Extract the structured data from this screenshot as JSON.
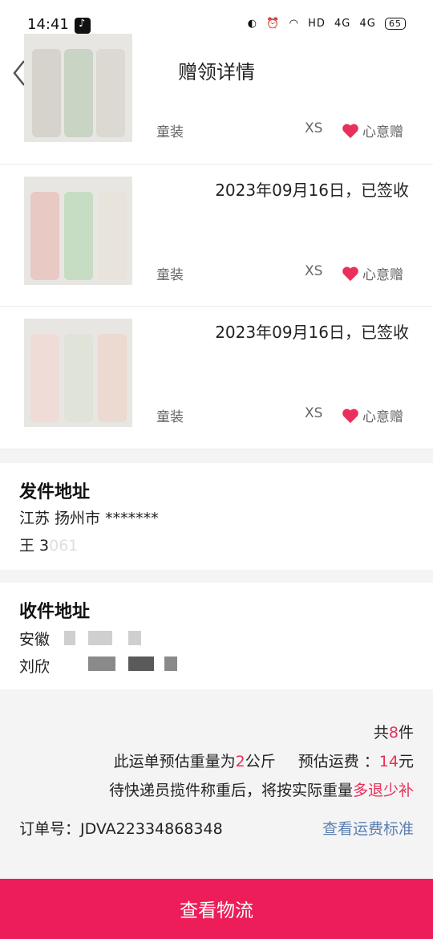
{
  "status": {
    "time": "14:41",
    "network": "HD",
    "signal1": "4G",
    "signal2": "4G",
    "battery": "65"
  },
  "nav": {
    "title": "赠领详情"
  },
  "items": [
    {
      "date": "",
      "category": "童装",
      "size": "XS",
      "tag": "心意赠"
    },
    {
      "date": "2023年09月16日，已签收",
      "category": "童装",
      "size": "XS",
      "tag": "心意赠"
    },
    {
      "date": "2023年09月16日，已签收",
      "category": "童装",
      "size": "XS",
      "tag": "心意赠"
    }
  ],
  "sender": {
    "title": "发件地址",
    "line1": "江苏 扬州市 *******",
    "line2": "王 3061"
  },
  "receiver": {
    "title": "收件地址",
    "line1": "安徽",
    "line2": "刘欣"
  },
  "summary": {
    "count_prefix": "共",
    "count": "8",
    "count_suffix": "件",
    "weight_prefix": "此运单预估重量为",
    "weight": "2",
    "weight_suffix": "公斤",
    "fee_prefix": "预估运费 ：",
    "fee": "14",
    "fee_suffix": "元",
    "note_prefix": "待快递员揽件称重后，将按实际重量",
    "note_highlight": "多退少补",
    "order_label": "订单号：JDVA22334868348",
    "fee_standard_link": "查看运费标准"
  },
  "bottom_button": "查看物流",
  "colors": {
    "accent": "#ec1d58",
    "highlight": "#e8305a",
    "link": "#5b7fb0"
  }
}
